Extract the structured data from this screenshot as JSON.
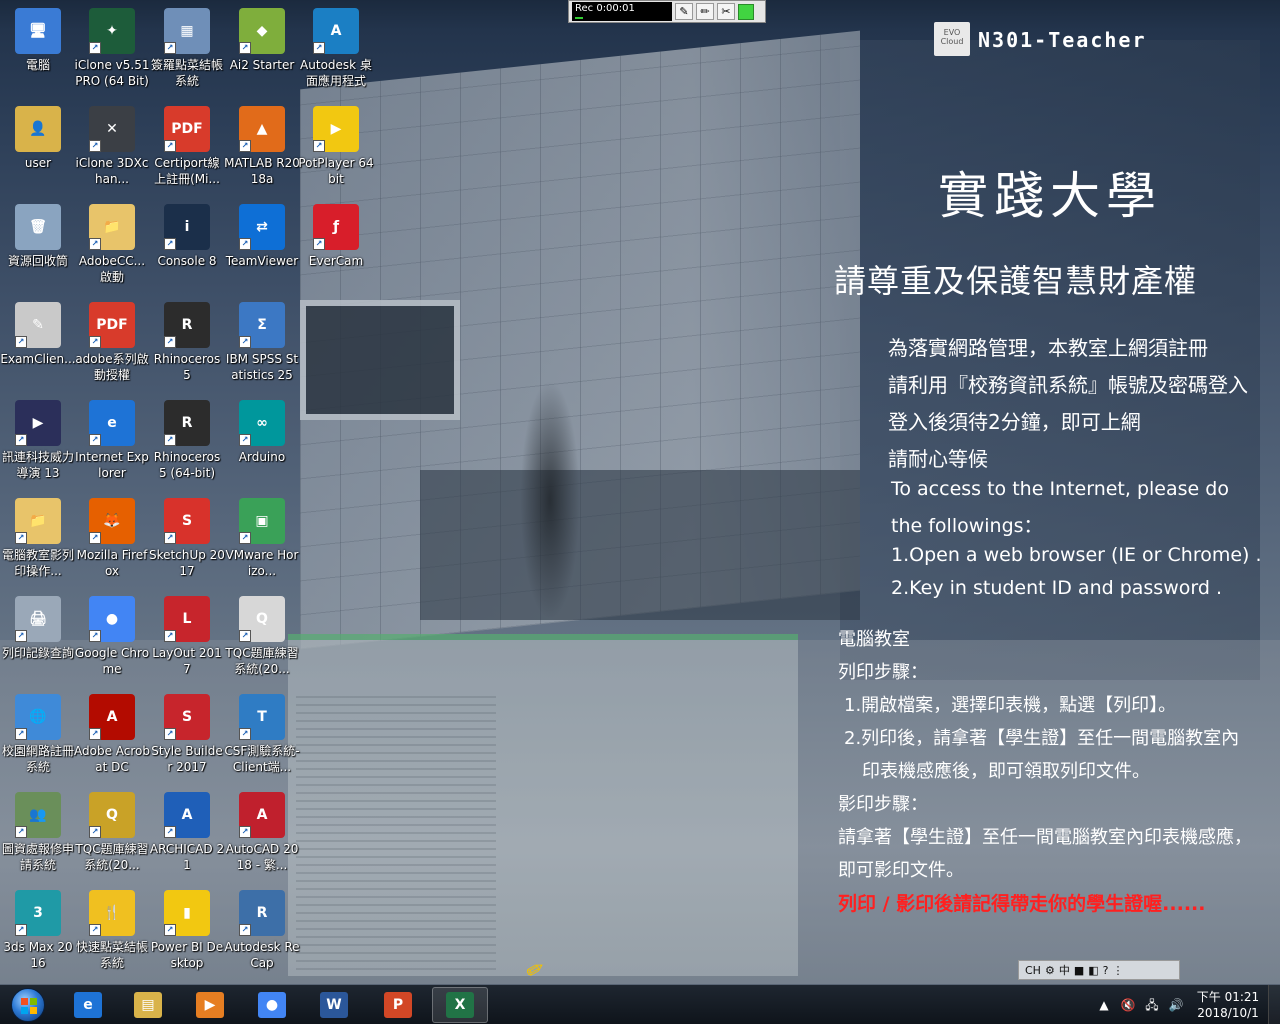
{
  "recorder": {
    "time": "Rec 0:00:01",
    "buttons": [
      "edit",
      "pencil",
      "scissors",
      "stop"
    ]
  },
  "brand": {
    "logo_text": "EVO Cloud",
    "machine_name": "N301-Teacher",
    "university": "實踐大學",
    "title": "請尊重及保護智慧財產權"
  },
  "notice": {
    "lines": [
      "為落實網路管理，本教室上網須註冊",
      "請利用『校務資訊系統』帳號及密碼登入",
      "登入後須待2分鐘，即可上網",
      "請耐心等候",
      "To access to the Internet, please do",
      " the followings：",
      "1.Open a web browser (IE or Chrome) .",
      "2.Key in student ID and password ."
    ],
    "lab": "電腦教室",
    "print_title": "列印步驟：",
    "print_1": "1.開啟檔案，選擇印表機，點選【列印】。",
    "print_2a": "2.列印後，請拿著【學生證】至任一間電腦教室內",
    "print_2b": "印表機感應後，即可領取列印文件。",
    "copy_title": "影印步驟：",
    "copy_1": "請拿著【學生證】至任一間電腦教室內印表機感應，",
    "copy_2": "即可影印文件。",
    "warning": "列印 / 影印後請記得帶走你的學生證喔......"
  },
  "icons": [
    {
      "label": "電腦",
      "glyph": "🖥",
      "color": "#3a7bd5"
    },
    {
      "label": "user",
      "glyph": "👤",
      "color": "#d9b34a"
    },
    {
      "label": "資源回收筒",
      "glyph": "🗑",
      "color": "#8aa4c0"
    },
    {
      "label": "ExamClien...",
      "glyph": "✎",
      "color": "#c9c9c9"
    },
    {
      "label": "訊連科技威力導演 13",
      "glyph": "▶",
      "color": "#2b2f5a"
    },
    {
      "label": "電腦教室影列印操作...",
      "glyph": "📁",
      "color": "#e8c46a"
    },
    {
      "label": "列印記錄查詢",
      "glyph": "🖨",
      "color": "#9aa8b8"
    },
    {
      "label": "校園網路註冊系統",
      "glyph": "🌐",
      "color": "#3f8ad8"
    },
    {
      "label": "圖資處報修申請系統",
      "glyph": "👥",
      "color": "#6a8f5a"
    },
    {
      "label": "3ds Max 2016",
      "glyph": "3",
      "color": "#1f9aa6"
    },
    {
      "label": "iClone v5.51 PRO (64 Bit)",
      "glyph": "✦",
      "color": "#1d5c3a"
    },
    {
      "label": "iClone 3DXchan...",
      "glyph": "✕",
      "color": "#3b3f45"
    },
    {
      "label": "AdobeCC...啟動",
      "glyph": "📁",
      "color": "#e8c46a"
    },
    {
      "label": "adobe系列啟動授權",
      "glyph": "PDF",
      "color": "#d83b2b"
    },
    {
      "label": "Internet Explorer",
      "glyph": "e",
      "color": "#1e73d6"
    },
    {
      "label": "Mozilla Firefox",
      "glyph": "🦊",
      "color": "#e66000"
    },
    {
      "label": "Google Chrome",
      "glyph": "●",
      "color": "#4285f4"
    },
    {
      "label": "Adobe Acrobat DC",
      "glyph": "A",
      "color": "#b30b00"
    },
    {
      "label": "TQC題庫練習系統(20...",
      "glyph": "Q",
      "color": "#c9a227"
    },
    {
      "label": "快速點菜結帳系統",
      "glyph": "🍴",
      "color": "#f0c020"
    },
    {
      "label": "簽羅點菜結帳系統",
      "glyph": "▦",
      "color": "#6f8fb8"
    },
    {
      "label": "Certiport線上註冊(Mi...",
      "glyph": "PDF",
      "color": "#d83b2b"
    },
    {
      "label": "Console 8",
      "glyph": "i",
      "color": "#1b2f4a"
    },
    {
      "label": "Rhinoceros 5",
      "glyph": "R",
      "color": "#2c2c2c"
    },
    {
      "label": "Rhinoceros 5 (64-bit)",
      "glyph": "R",
      "color": "#2c2c2c"
    },
    {
      "label": "SketchUp 2017",
      "glyph": "S",
      "color": "#d8322b"
    },
    {
      "label": "LayOut 2017",
      "glyph": "L",
      "color": "#c7252c"
    },
    {
      "label": "Style Builder 2017",
      "glyph": "S",
      "color": "#c7252c"
    },
    {
      "label": "ARCHICAD 21",
      "glyph": "A",
      "color": "#1f5fb8"
    },
    {
      "label": "Power BI Desktop",
      "glyph": "▮",
      "color": "#f2c811"
    },
    {
      "label": "Ai2 Starter",
      "glyph": "◆",
      "color": "#7fae3c"
    },
    {
      "label": "MATLAB R2018a",
      "glyph": "▲",
      "color": "#e16b1a"
    },
    {
      "label": "TeamViewer",
      "glyph": "⇄",
      "color": "#0e6fd6"
    },
    {
      "label": "IBM SPSS Statistics 25",
      "glyph": "Σ",
      "color": "#3c78c4"
    },
    {
      "label": "Arduino",
      "glyph": "∞",
      "color": "#00979c"
    },
    {
      "label": "VMware Horizo...",
      "glyph": "▣",
      "color": "#3aa158"
    },
    {
      "label": "TQC題庫練習系統(20...",
      "glyph": "Q",
      "color": "#d7d7d7"
    },
    {
      "label": "CSF測驗系統-Client端...",
      "glyph": "T",
      "color": "#2f7cc4"
    },
    {
      "label": "AutoCAD 2018 - 繁...",
      "glyph": "A",
      "color": "#c0202d"
    },
    {
      "label": "Autodesk ReCap",
      "glyph": "R",
      "color": "#3d6fa8"
    },
    {
      "label": "Autodesk 桌面應用程式",
      "glyph": "A",
      "color": "#1b7fc4"
    },
    {
      "label": "PotPlayer 64 bit",
      "glyph": "▶",
      "color": "#f2c811"
    },
    {
      "label": "EverCam",
      "glyph": "ƒ",
      "color": "#d81e2a"
    }
  ],
  "taskbar": {
    "apps": [
      {
        "name": "internet-explorer",
        "glyph": "e",
        "color": "#1e73d6"
      },
      {
        "name": "file-explorer",
        "glyph": "▤",
        "color": "#d9b34a"
      },
      {
        "name": "media-player",
        "glyph": "▶",
        "color": "#e67e22"
      },
      {
        "name": "chrome",
        "glyph": "●",
        "color": "#4285f4"
      },
      {
        "name": "word",
        "glyph": "W",
        "color": "#2b579a"
      },
      {
        "name": "powerpoint",
        "glyph": "P",
        "color": "#d24726"
      },
      {
        "name": "excel",
        "glyph": "X",
        "color": "#217346"
      }
    ],
    "tray_icons": [
      "▲",
      "🔇",
      "🖧",
      "🔊"
    ],
    "clock_time": "下午 01:21",
    "clock_date": "2018/10/1"
  },
  "ime": {
    "lang": "CH",
    "mode": "中",
    "extra": "?"
  }
}
